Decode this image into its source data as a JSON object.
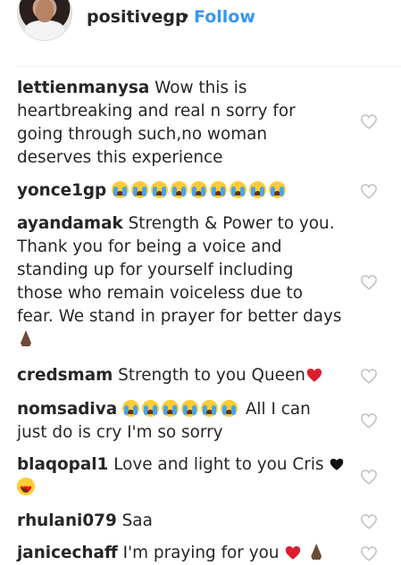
{
  "header": {
    "username": "positivegp",
    "separator": "•",
    "follow_label": "Follow"
  },
  "comments": [
    {
      "user": "lettienmanysa",
      "text": "Wow this is heartbreaking and real n sorry for going through such,no woman deserves this experience",
      "line1": "Wow this is",
      "line2": "heartbreaking and real n sorry for",
      "line3": "going through such,no woman",
      "line4": "deserves this experience"
    },
    {
      "user": "yonce1gp",
      "emojis": "crying-face x9"
    },
    {
      "user": "ayandamak",
      "line1": "Strength & Power to you.",
      "line2": "Thank you for being a voice and",
      "line3": "standing up for yourself including",
      "line4": "those who remain voiceless due to",
      "line5": "fear. We stand in prayer for better days",
      "emojis": "folded-hands"
    },
    {
      "user": "credsmam",
      "text": "Strength to you Queen",
      "emojis": "red-heart"
    },
    {
      "user": "nomsadiva",
      "text_after": "All I can",
      "line2": "just do is cry I'm so sorry",
      "emojis": "crying-face x6"
    },
    {
      "user": "blaqopal1",
      "text": "Love and light to you Cris",
      "emojis": "black-heart, heart-eyes"
    },
    {
      "user": "rhulani079",
      "text": "Saa"
    },
    {
      "user": "janicechaff",
      "text": "I'm praying for you",
      "emojis": "red-heart, folded-hands"
    }
  ],
  "icons": {
    "like": "heart-outline-icon"
  },
  "colors": {
    "follow": "#3897f0",
    "text": "#262626",
    "heart_outline": "#bfbfbf"
  }
}
